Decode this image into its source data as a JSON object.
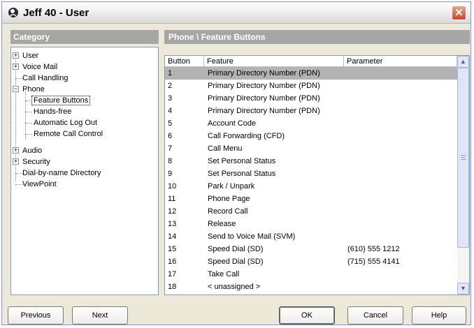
{
  "window": {
    "title": "Jeff 40 - User",
    "close_glyph": "✕"
  },
  "left_panel": {
    "header": "Category"
  },
  "right_panel": {
    "header": "Phone \\ Feature Buttons"
  },
  "tree": {
    "items": [
      {
        "label": "User",
        "expander": "+"
      },
      {
        "label": "Voice Mail",
        "expander": "+"
      },
      {
        "label": "Call Handling"
      },
      {
        "label": "Phone",
        "expander": "−"
      },
      {
        "label": "Feature Buttons"
      },
      {
        "label": "Hands-free"
      },
      {
        "label": "Automatic Log Out"
      },
      {
        "label": "Remote Call Control"
      },
      {
        "label": "Audio",
        "expander": "+"
      },
      {
        "label": "Security",
        "expander": "+"
      },
      {
        "label": "Dial-by-name Directory"
      },
      {
        "label": "ViewPoint"
      }
    ]
  },
  "table": {
    "columns": [
      "Button",
      "Feature",
      "Parameter"
    ],
    "rows": [
      {
        "button": "1",
        "feature": "Primary Directory Number (PDN)",
        "parameter": ""
      },
      {
        "button": "2",
        "feature": "Primary Directory Number (PDN)",
        "parameter": ""
      },
      {
        "button": "3",
        "feature": "Primary Directory Number (PDN)",
        "parameter": ""
      },
      {
        "button": "4",
        "feature": "Primary Directory Number (PDN)",
        "parameter": ""
      },
      {
        "button": "5",
        "feature": "Account Code",
        "parameter": ""
      },
      {
        "button": "6",
        "feature": "Call Forwarding (CFD)",
        "parameter": ""
      },
      {
        "button": "7",
        "feature": "Call Menu",
        "parameter": ""
      },
      {
        "button": "8",
        "feature": "Set Personal Status",
        "parameter": ""
      },
      {
        "button": "9",
        "feature": "Set Personal Status",
        "parameter": ""
      },
      {
        "button": "10",
        "feature": "Park / Unpark",
        "parameter": ""
      },
      {
        "button": "11",
        "feature": "Phone Page",
        "parameter": ""
      },
      {
        "button": "12",
        "feature": "Record Call",
        "parameter": ""
      },
      {
        "button": "13",
        "feature": "Release",
        "parameter": ""
      },
      {
        "button": "14",
        "feature": "Send to Voice Mail (SVM)",
        "parameter": ""
      },
      {
        "button": "15",
        "feature": "Speed Dial (SD)",
        "parameter": "(610) 555 1212"
      },
      {
        "button": "16",
        "feature": "Speed Dial (SD)",
        "parameter": "(715) 555 4141"
      },
      {
        "button": "17",
        "feature": "Take Call",
        "parameter": ""
      },
      {
        "button": "18",
        "feature": "< unassigned >",
        "parameter": ""
      }
    ],
    "selected_row": "1"
  },
  "buttons": {
    "previous": "Previous",
    "next": "Next",
    "ok": "OK",
    "cancel": "Cancel",
    "help": "Help"
  },
  "colors": {
    "header_bg": "#a6a6a6",
    "selection": "#b3b3b3",
    "close_red": "#c9472a"
  }
}
